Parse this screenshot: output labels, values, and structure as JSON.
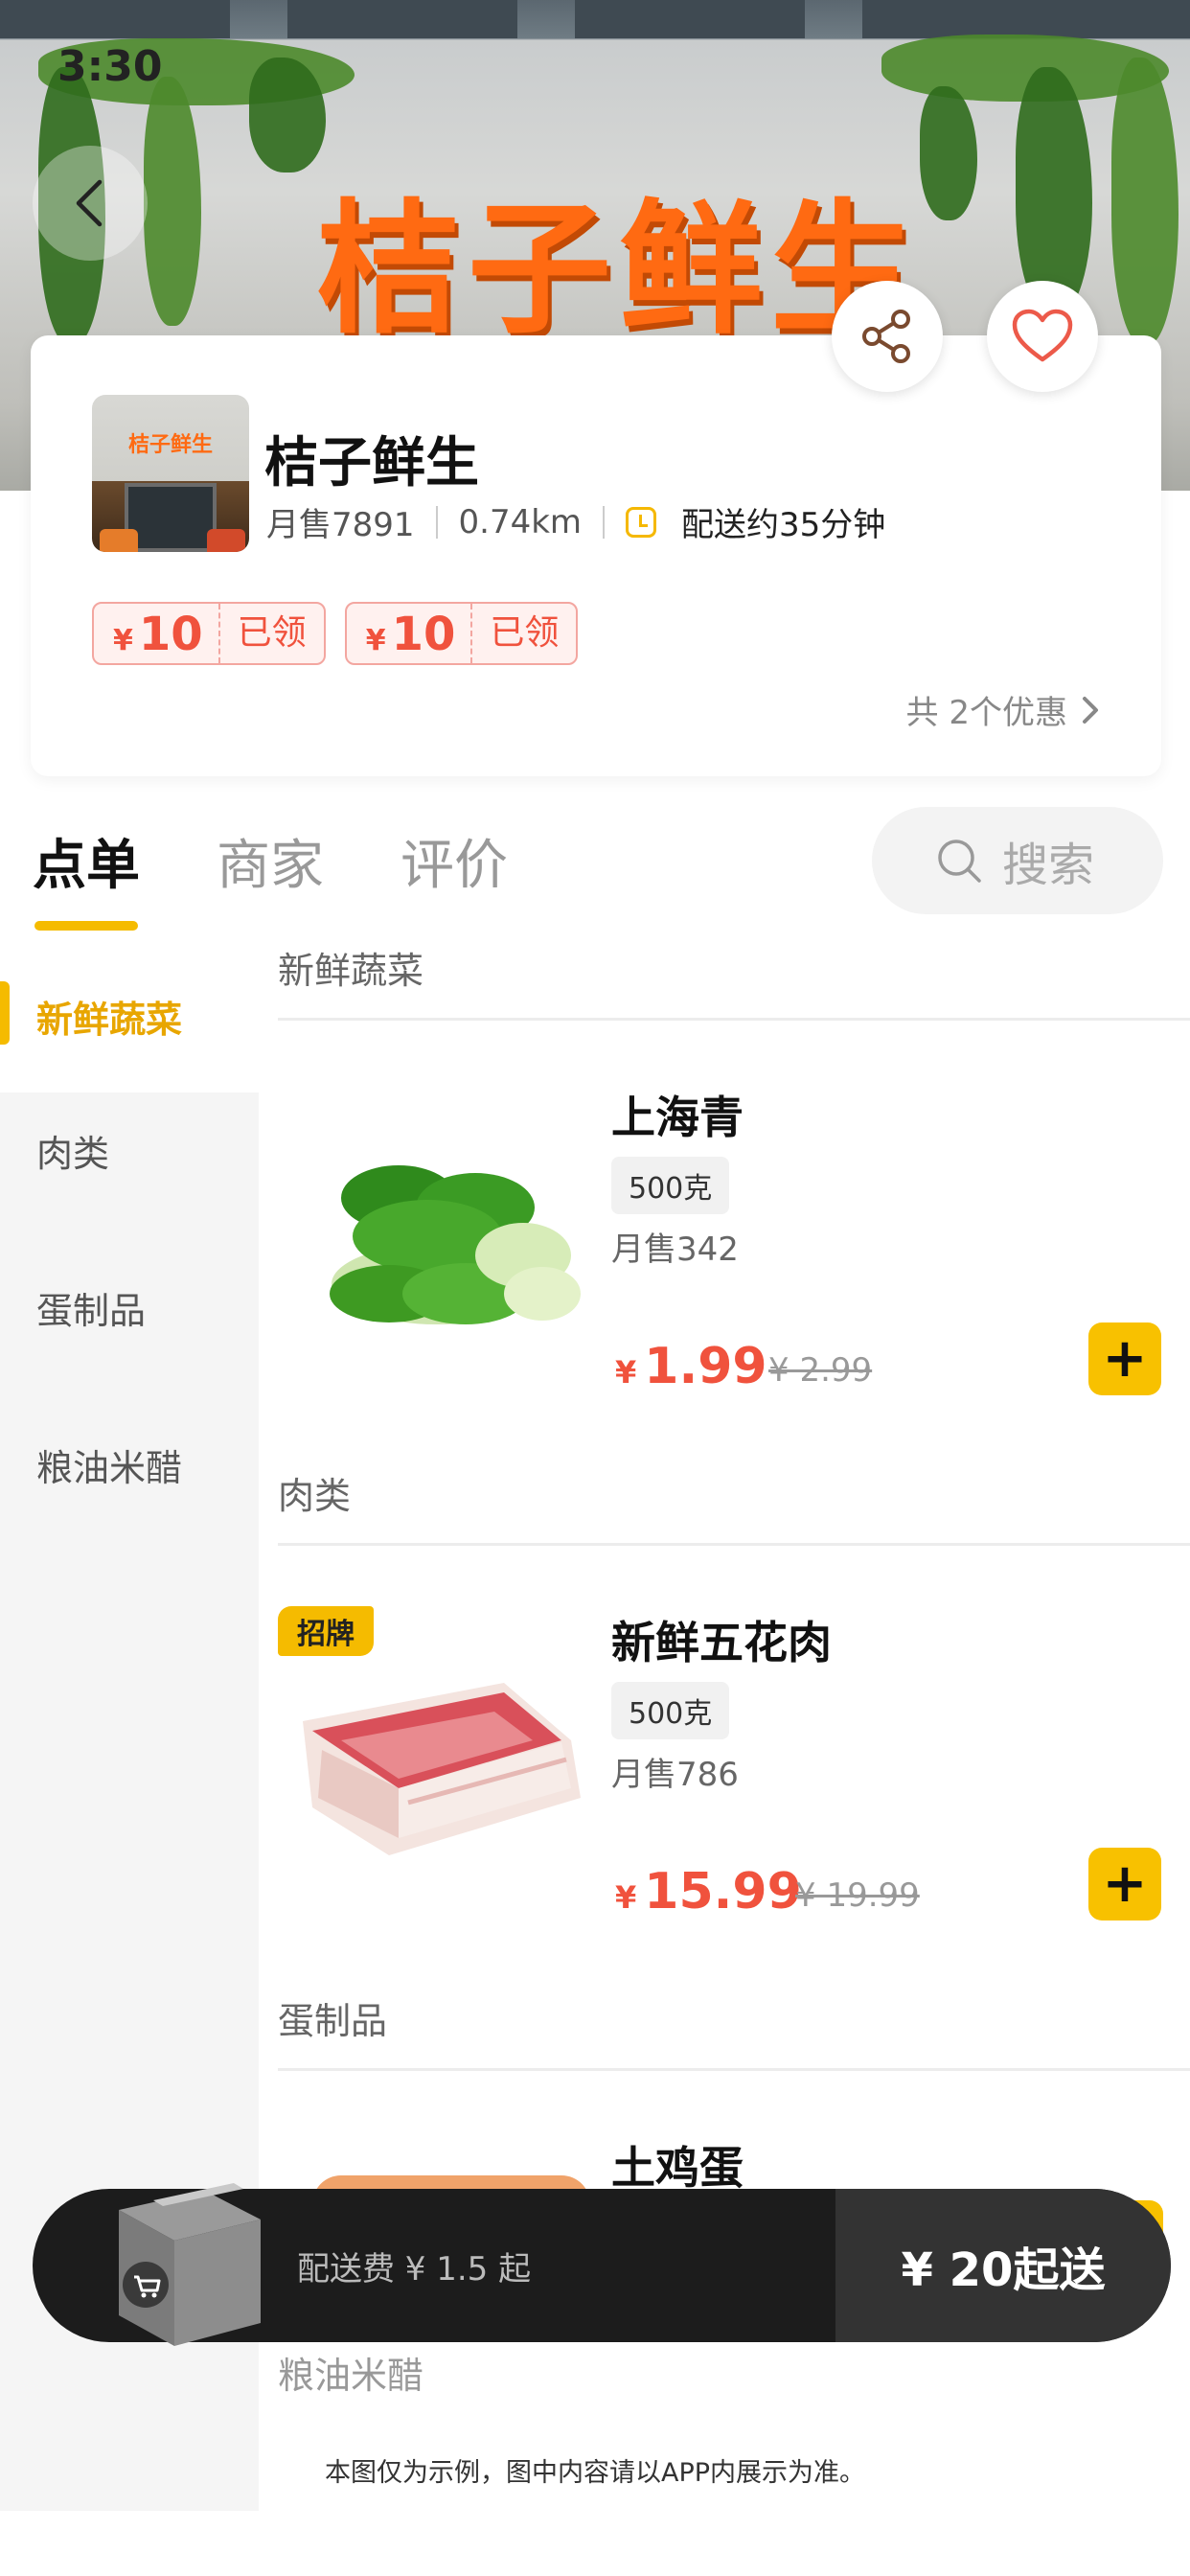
{
  "status_bar": {
    "time": "3:30"
  },
  "hero": {
    "sign_text": "桔子鲜生"
  },
  "store": {
    "name": "桔子鲜生",
    "thumb_sign": "桔子鲜生",
    "monthly_sales": "月售7891",
    "distance": "0.74km",
    "delivery_time": "配送约35分钟",
    "coupons": [
      {
        "currency": "¥",
        "amount": "10",
        "status": "已领"
      },
      {
        "currency": "¥",
        "amount": "10",
        "status": "已领"
      }
    ],
    "promo_more": "共 2个优惠"
  },
  "tabs": [
    {
      "label": "点单",
      "active": true
    },
    {
      "label": "商家",
      "active": false
    },
    {
      "label": "评价",
      "active": false
    }
  ],
  "search": {
    "placeholder": "搜索"
  },
  "categories": [
    {
      "label": "新鲜蔬菜",
      "active": true
    },
    {
      "label": "肉类",
      "active": false
    },
    {
      "label": "蛋制品",
      "active": false
    },
    {
      "label": "粮油米醋",
      "active": false
    }
  ],
  "sections": [
    {
      "title": "新鲜蔬菜",
      "products": [
        {
          "name": "上海青",
          "spec": "500克",
          "sold": "月售342",
          "currency": "¥",
          "price": "1.99",
          "original_price": "¥ 2.99",
          "badge": ""
        }
      ]
    },
    {
      "title": "肉类",
      "products": [
        {
          "name": "新鲜五花肉",
          "spec": "500克",
          "sold": "月售786",
          "currency": "¥",
          "price": "15.99",
          "original_price": "¥ 19.99",
          "badge": "招牌"
        }
      ]
    },
    {
      "title": "蛋制品",
      "products": [
        {
          "name": "土鸡蛋"
        }
      ]
    },
    {
      "title": "粮油米醋"
    }
  ],
  "cart": {
    "delivery_fee": "配送费 ¥ 1.5 起",
    "min_order": "¥ 20起送"
  },
  "disclaimer": "本图仅为示例，图中内容请以APP内展示为准。",
  "colors": {
    "accent": "#f5bb00",
    "price": "#f0523d",
    "brand_orange": "#ff6a12",
    "cart_bg": "#1c1c1c"
  },
  "icons": [
    "back-arrow-icon",
    "share-icon",
    "heart-icon",
    "clock-icon",
    "chevron-right-icon",
    "search-icon",
    "plus-icon",
    "delivery-box-icon"
  ]
}
